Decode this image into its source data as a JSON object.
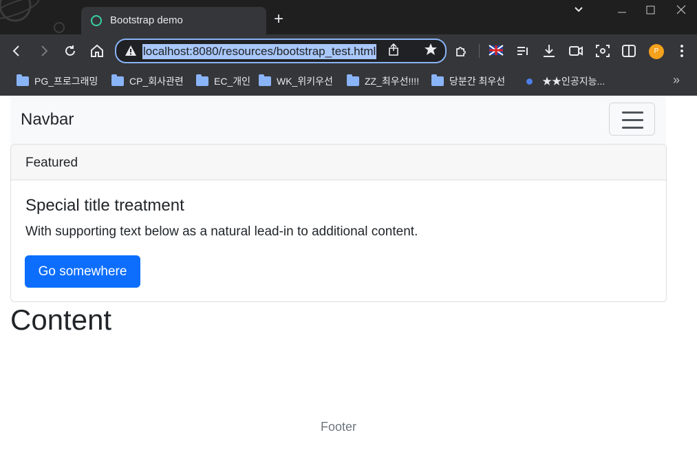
{
  "browser": {
    "tab": {
      "title": "Bootstrap demo"
    },
    "new_tab_label": "+",
    "address_bar": {
      "url": "localhost:8080/resources/bootstrap_test.html"
    },
    "profile_initial": "P",
    "bookmarks": [
      {
        "label": "PG_프로그래밍",
        "type": "folder"
      },
      {
        "label": "CP_회사관련",
        "type": "folder"
      },
      {
        "label": "EC_개인",
        "type": "folder"
      },
      {
        "label": "WK_위키우선",
        "type": "folder"
      },
      {
        "label": "ZZ_최우선!!!!",
        "type": "folder"
      },
      {
        "label": "당분간 최우선",
        "type": "folder"
      },
      {
        "label": "★★인공지능...",
        "type": "link"
      }
    ],
    "bookmarks_more": "»"
  },
  "page": {
    "navbar": {
      "brand": "Navbar"
    },
    "card": {
      "header": "Featured",
      "title": "Special title treatment",
      "text": "With supporting text below as a natural lead-in to additional content.",
      "button_label": "Go somewhere"
    },
    "content_heading": "Content",
    "footer": "Footer"
  },
  "colors": {
    "primary": "#0d6efd",
    "navbar_bg": "#f8f9fa",
    "chrome_bg": "#35363a",
    "omnibox_focus": "#8ab4f8"
  }
}
